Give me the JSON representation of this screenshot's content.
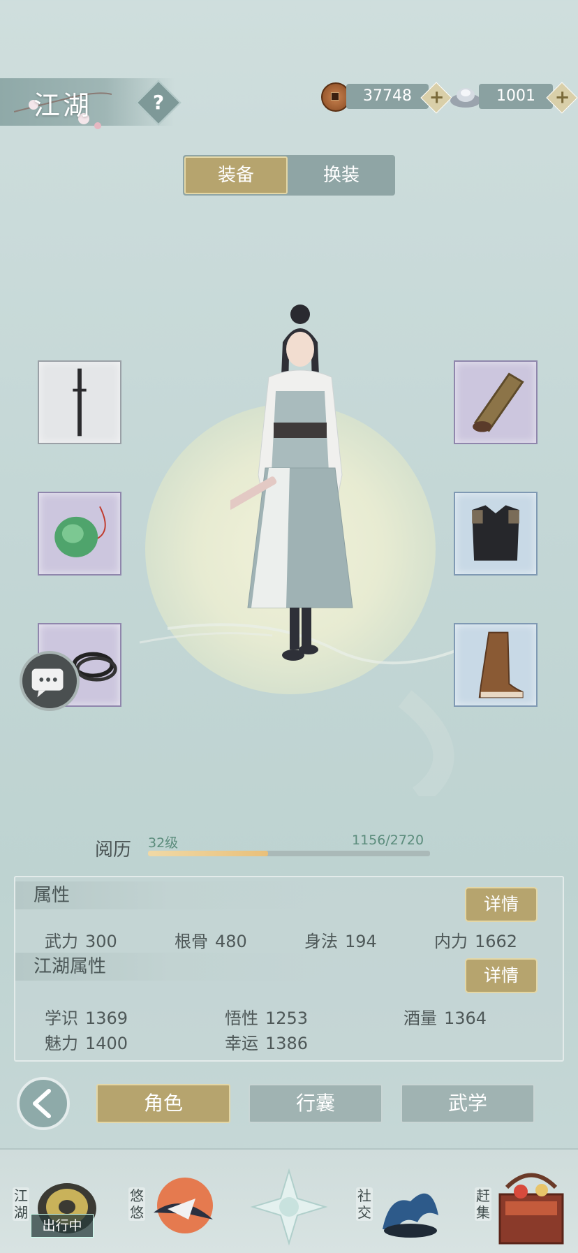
{
  "header": {
    "title": "江湖",
    "help_label": "?",
    "copper": "37748",
    "silver": "1001",
    "plus": "+"
  },
  "tabs": {
    "equip": "装备",
    "outfit": "换装"
  },
  "experience": {
    "label": "阅历",
    "level": "32级",
    "value": "1156/2720",
    "progress": 0.425
  },
  "attributes": {
    "title": "属性",
    "detail": "详情",
    "stats": [
      {
        "name": "武力",
        "value": "300"
      },
      {
        "name": "根骨",
        "value": "480"
      },
      {
        "name": "身法",
        "value": "194"
      },
      {
        "name": "内力",
        "value": "1662"
      }
    ]
  },
  "jianghu": {
    "title": "江湖属性",
    "detail": "详情",
    "stats": [
      {
        "name": "学识",
        "value": "1369"
      },
      {
        "name": "悟性",
        "value": "1253"
      },
      {
        "name": "酒量",
        "value": "1364"
      },
      {
        "name": "魅力",
        "value": "1400"
      },
      {
        "name": "幸运",
        "value": "1386"
      }
    ]
  },
  "bottom_tabs": [
    "角色",
    "行囊",
    "武学"
  ],
  "nav": {
    "jianghu": "江湖",
    "youyou": "悠悠",
    "social": "社交",
    "market": "赶集",
    "traveling": "出行中"
  },
  "colors": {
    "gold_button": "#b6a46e",
    "background": "#c4d7d6",
    "exp_fill": "#e9c07a"
  }
}
